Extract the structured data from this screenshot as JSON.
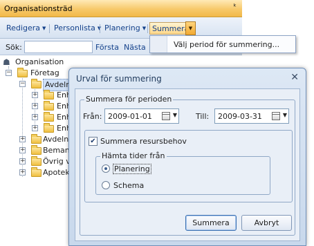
{
  "panel": {
    "title": "Organisationsträd",
    "pin_glyph": "⇩"
  },
  "toolbar": {
    "edit_label": "Redigera",
    "staff_label": "Personlista",
    "planning_label": "Planering",
    "summary_label": "Summera",
    "arrow_glyph": "▼"
  },
  "menu": {
    "item": "Välj period för summering..."
  },
  "search": {
    "label": "Sök:",
    "value": "",
    "first": "Första",
    "next": "Nästa"
  },
  "tree": {
    "root": "Organisation",
    "company": "Företag",
    "dept_selected": "Avdelni",
    "units": [
      "Enh",
      "Enh",
      "Enh",
      "Enh"
    ],
    "others": [
      "Avdelni",
      "Bemann",
      "Övrig ve",
      "Apotek"
    ]
  },
  "dialog": {
    "title": "Urval för summering",
    "close_glyph": "✕",
    "period_group": "Summera för perioden",
    "from_label": "Från:",
    "from_value": "2009-01-01",
    "to_label": "Till:",
    "to_value": "2009-03-31",
    "summarize_resources": "Summera resursbehov",
    "summarize_checked": true,
    "fetch_group": "Hämta tider från",
    "option_planning": "Planering",
    "option_schedule": "Schema",
    "selected_option": "Planering",
    "ok_button": "Summera",
    "cancel_button": "Avbryt"
  }
}
